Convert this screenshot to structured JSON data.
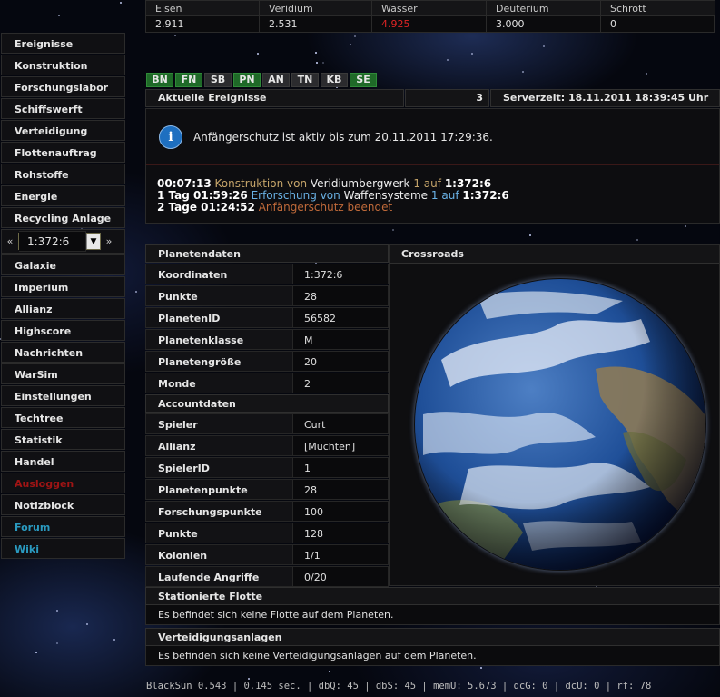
{
  "resources": [
    {
      "name": "Eisen",
      "value": "2.911",
      "alert": false
    },
    {
      "name": "Veridium",
      "value": "2.531",
      "alert": false
    },
    {
      "name": "Wasser",
      "value": "4.925",
      "alert": true
    },
    {
      "name": "Deuterium",
      "value": "3.000",
      "alert": false
    },
    {
      "name": "Schrott",
      "value": "0",
      "alert": false
    }
  ],
  "nav": {
    "group1": [
      "Ereignisse",
      "Konstruktion",
      "Forschungslabor",
      "Schiffswerft",
      "Verteidigung",
      "Flottenauftrag",
      "Rohstoffe",
      "Energie",
      "Recycling Anlage"
    ],
    "planet_select": {
      "prev": "«",
      "value": "1:372:6",
      "next": "»"
    },
    "group2": [
      "Galaxie",
      "Imperium",
      "Allianz",
      "Highscore",
      "Nachrichten",
      "WarSim"
    ],
    "group3": [
      "Einstellungen",
      "Techtree",
      "Statistik",
      "Handel"
    ],
    "logout": "Ausloggen",
    "notes": "Notizblock",
    "forum": "Forum",
    "wiki": "Wiki"
  },
  "tabs": [
    {
      "label": "BN",
      "green": true
    },
    {
      "label": "FN",
      "green": true
    },
    {
      "label": "SB",
      "green": false
    },
    {
      "label": "PN",
      "green": true
    },
    {
      "label": "AN",
      "green": false
    },
    {
      "label": "TN",
      "green": false
    },
    {
      "label": "KB",
      "green": false
    },
    {
      "label": "SE",
      "green": true
    }
  ],
  "events": {
    "title": "Aktuelle Ereignisse",
    "count": "3",
    "server_time": "Serverzeit: 18.11.2011 18:39:45 Uhr",
    "notice": "Anfängerschutz ist aktiv bis zum 20.11.2011 17:29:36.",
    "list": [
      {
        "time": "00:07:13",
        "kind": "Konstruktion",
        "von": "von",
        "target": "Veridiumbergwerk",
        "level": "1",
        "auf": "auf",
        "coords": "1:372:6"
      },
      {
        "time": "1 Tag 01:59:26",
        "kind": "Erforschung",
        "von": "von",
        "target": "Waffensysteme",
        "level": "1",
        "auf": "auf",
        "coords": "1:372:6"
      },
      {
        "time": "2 Tage 01:24:52",
        "text": "Anfängerschutz beendet"
      }
    ]
  },
  "planet": {
    "title": "Planetendaten",
    "rows": [
      {
        "label": "Koordinaten",
        "value": "1:372:6"
      },
      {
        "label": "Punkte",
        "value": "28"
      },
      {
        "label": "PlanetenID",
        "value": "56582"
      },
      {
        "label": "Planetenklasse",
        "value": "M"
      },
      {
        "label": "Planetengröße",
        "value": "20"
      },
      {
        "label": "Monde",
        "value": "2"
      }
    ]
  },
  "account": {
    "title": "Accountdaten",
    "rows": [
      {
        "label": "Spieler",
        "value": "Curt"
      },
      {
        "label": "Allianz",
        "value": "[Muchten]"
      },
      {
        "label": "SpielerID",
        "value": "1"
      },
      {
        "label": "Planetenpunkte",
        "value": "28"
      },
      {
        "label": "Forschungspunkte",
        "value": "100"
      },
      {
        "label": "Punkte",
        "value": "128"
      },
      {
        "label": "Kolonien",
        "value": "1/1"
      },
      {
        "label": "Laufende Angriffe",
        "value": "0/20"
      }
    ]
  },
  "planet_name": "Crossroads",
  "fleet": {
    "title": "Stationierte Flotte",
    "text": "Es befindet sich keine Flotte auf dem Planeten."
  },
  "defense": {
    "title": "Verteidigungsanlagen",
    "text": "Es befinden sich keine Verteidigungsanlagen auf dem Planeten."
  },
  "footer": "BlackSun 0.543 | 0.145 sec. | dbQ: 45 | dbS: 45 | memU: 5.673 | dcG: 0 | dcU: 0 | rf: 78",
  "icons": {
    "info": "info-icon",
    "dropdown": "chevron-down-icon"
  }
}
